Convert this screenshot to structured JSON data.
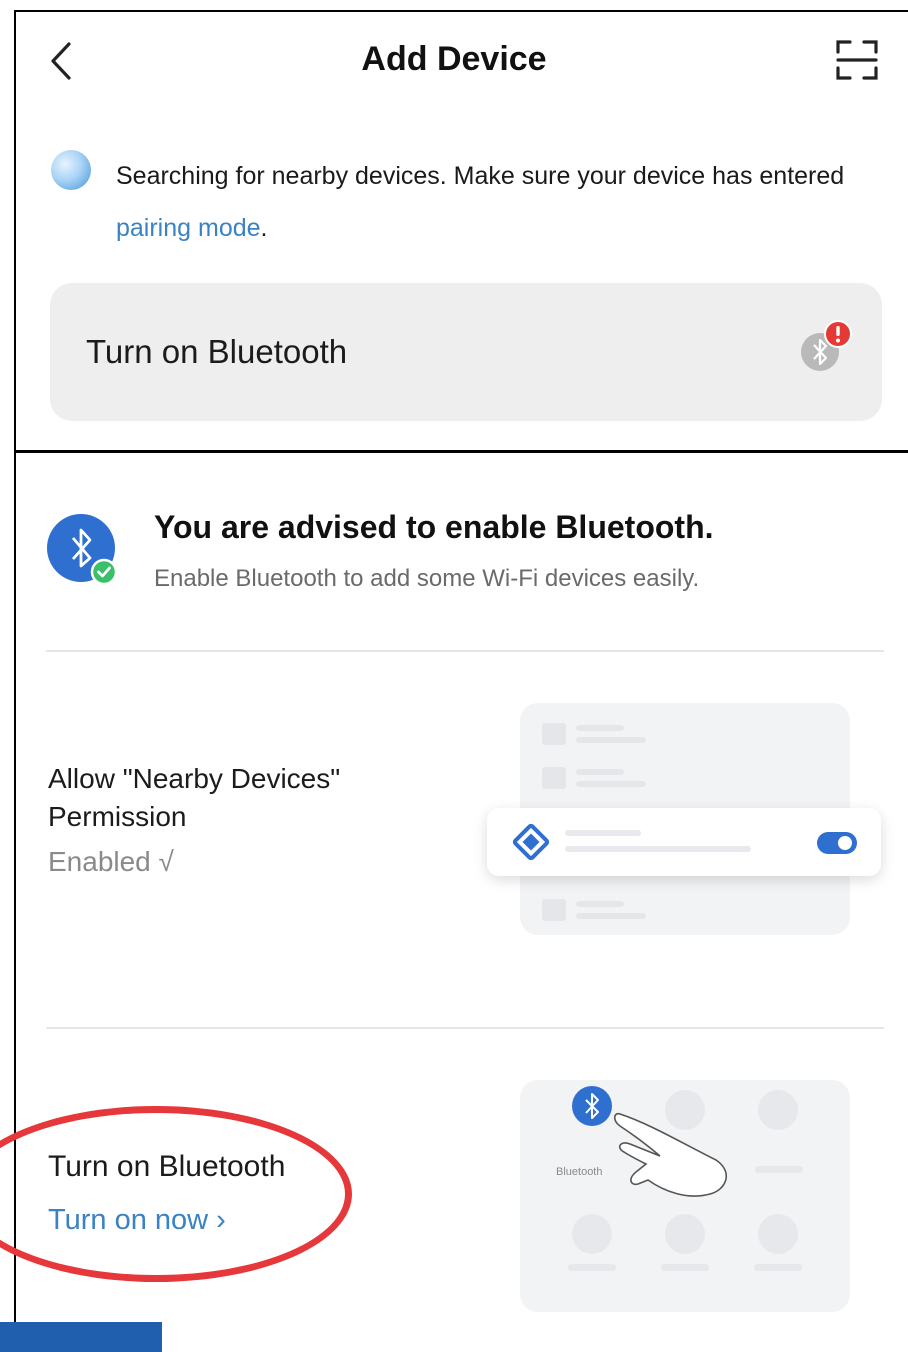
{
  "header": {
    "title": "Add Device",
    "back_icon": "chevron-left-icon",
    "scan_icon": "scan-icon"
  },
  "search": {
    "text_before": "Searching for nearby devices. Make sure your device has entered ",
    "link": "pairing mode",
    "text_after": "."
  },
  "bluetooth_card": {
    "label": "Turn on Bluetooth",
    "icon": "bluetooth-warning-icon"
  },
  "advice": {
    "title": "You are advised to enable Bluetooth.",
    "subtitle": "Enable Bluetooth to add some Wi-Fi devices easily."
  },
  "permission": {
    "title": "Allow \"Nearby Devices\" Permission",
    "status": "Enabled √"
  },
  "bluetooth_step": {
    "title": "Turn on Bluetooth",
    "link": "Turn on now ›",
    "illustration_label": "Bluetooth"
  },
  "colors": {
    "accent": "#3a82c4",
    "bluetooth_blue": "#2f6fd0",
    "warning_red": "#e53935",
    "success_green": "#3bbf6a",
    "annotation_red": "#e6373a",
    "card_bg": "#eeeeee"
  }
}
